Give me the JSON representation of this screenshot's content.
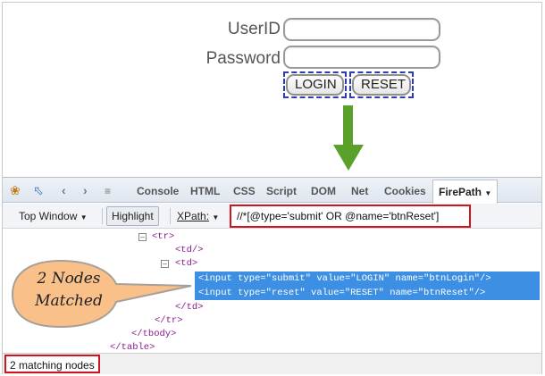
{
  "login": {
    "userid_label": "UserID",
    "password_label": "Password",
    "userid_value": "",
    "password_value": "",
    "login_button": "LOGIN",
    "reset_button": "RESET"
  },
  "tabs": [
    "Console",
    "HTML",
    "CSS",
    "Script",
    "DOM",
    "Net",
    "Cookies"
  ],
  "active_tab": "FirePath",
  "toolbar": {
    "frame_select": "Top Window",
    "highlight_button": "Highlight",
    "xpath_label": "XPath:",
    "xpath_value": "//*[@type='submit' OR @name='btnReset']"
  },
  "tree": {
    "tr_open": "<tr>",
    "td_empty": "<td/>",
    "td_open": "<td>",
    "input_login": "<input type=\"submit\" value=\"LOGIN\" name=\"btnLogin\"/>",
    "input_reset": "<input type=\"reset\" value=\"RESET\" name=\"btnReset\"/>",
    "td_close": "</td>",
    "tr_close": "</tr>",
    "tbody_close": "</tbody>",
    "table_close": "</table>"
  },
  "callout": {
    "line1": "2 Nodes",
    "line2": "Matched"
  },
  "status": {
    "text": "2 matching nodes"
  },
  "colors": {
    "annotation_red": "#d0141e",
    "selection_blue": "#3c8fe3",
    "arrow_green": "#5aa12b",
    "callout_fill": "#f9c08a"
  }
}
